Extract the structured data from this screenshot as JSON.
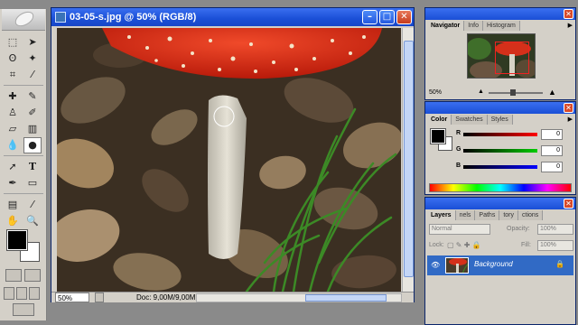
{
  "document": {
    "title": "03-05-s.jpg @ 50% (RGB/8)",
    "zoom": "50%",
    "doc_info": "Doc: 9,00M/9,00M"
  },
  "navigator": {
    "tabs": [
      "Navigator",
      "Info",
      "Histogram"
    ],
    "zoom": "50%"
  },
  "color_panel": {
    "tabs": [
      "Color",
      "Swatches",
      "Styles"
    ],
    "channels": [
      {
        "label": "R",
        "value": "0"
      },
      {
        "label": "G",
        "value": "0"
      },
      {
        "label": "B",
        "value": "0"
      }
    ],
    "foreground": "#000000",
    "background": "#ffffff"
  },
  "layers_panel": {
    "tabs": [
      "Layers",
      "nels",
      "Paths",
      "tory",
      "ctions"
    ],
    "blend_mode": "Normal",
    "opacity_label": "Opacity:",
    "opacity_value": "100%",
    "lock_label": "Lock:",
    "fill_label": "Fill:",
    "fill_value": "100%",
    "layer_name": "Background"
  },
  "icons": {
    "tools": [
      "marquee-icon",
      "move-icon",
      "lasso-icon",
      "magic-wand-icon",
      "crop-icon",
      "slice-icon",
      "healing-icon",
      "brush-icon",
      "stamp-icon",
      "history-brush-icon",
      "eraser-icon",
      "gradient-icon",
      "blur-icon",
      "dodge-icon",
      "path-select-icon",
      "type-icon",
      "pen-icon",
      "shape-icon",
      "notes-icon",
      "eyedropper-icon",
      "hand-icon",
      "zoom-icon"
    ]
  }
}
